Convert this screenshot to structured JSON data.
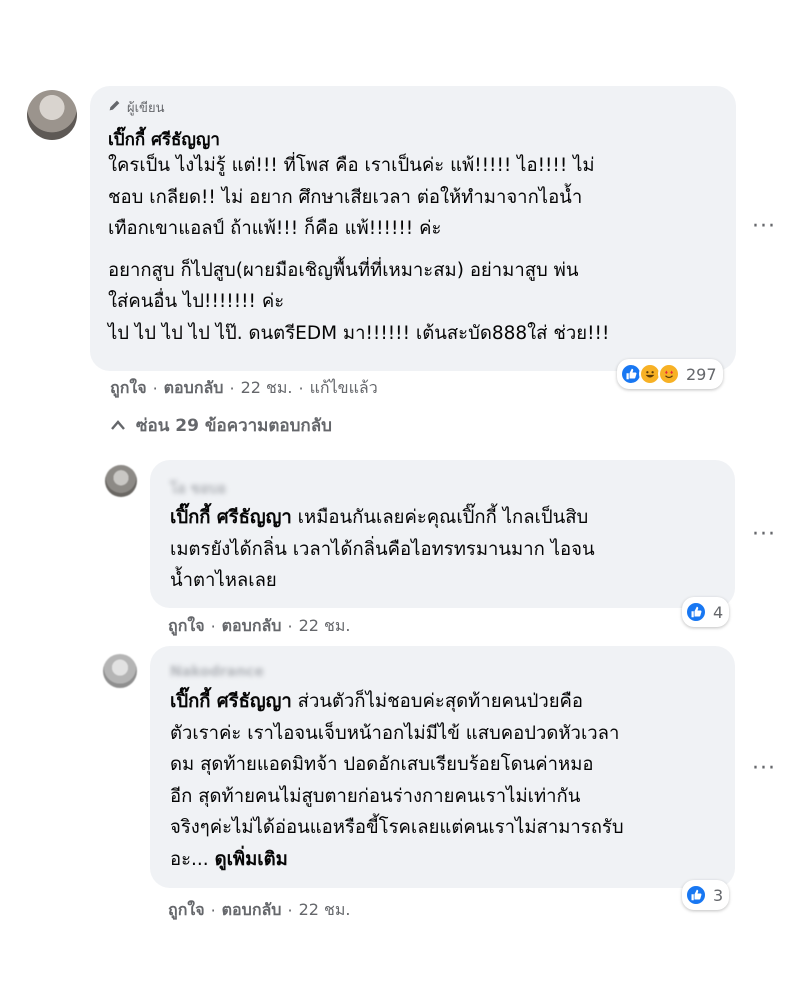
{
  "main_comment": {
    "badge_label": "ผู้เขียน",
    "author": "เปิ๊กกี้ ศรีธัญญา",
    "paragraphs": [
      [
        "ใครเป็น ไงไม่รู้ แต่!!! ที่โพส คือ เราเป็นค่ะ แพ้!!!!! ไอ!!!! ไม่",
        "ชอบ เกลียด!! ไม่ อยาก ศึกษาเสียเวลา ต่อให้ทำมาจากไอน้ำ",
        "เทือกเขาแอลป์ ถ้าแพ้!!! ก็คือ แพ้!!!!!! ค่ะ"
      ],
      [
        "อยากสูบ ก็ไปสูบ(ผายมือเชิญพื้นที่ที่เหมาะสม) อย่ามาสูบ พ่น",
        "ใส่คนอื่น ไป!!!!!!! ค่ะ",
        "ไป ไป ไป ไป ไป๊. ดนตรีEDM มา!!!!!! เต้นสะบัด888ใส่ ช่วย!!!"
      ]
    ],
    "meta": {
      "like": "ถูกใจ",
      "reply": "ตอบกลับ",
      "time": "22 ชม.",
      "edited": "แก้ไขแล้ว"
    },
    "reactions": {
      "icons": [
        "like-icon",
        "haha-icon",
        "love-face-icon"
      ],
      "count": "297"
    }
  },
  "hide_replies": "ซ่อน 29 ข้อความตอบกลับ",
  "replies": [
    {
      "author_blurred": "โอ ขอบอ",
      "mention": "เปิ๊กกี้ ศรีธัญญา",
      "lines": [
        " เหมือนกันเลยค่ะคุณเปิ๊กกี้ ไกลเป็นสิบ",
        "เมตรยังได้กลิ่น เวลาได้กลิ่นคือไอทรทรมานมาก ไอจน",
        "น้ำตาไหลเลย"
      ],
      "meta": {
        "like": "ถูกใจ",
        "reply": "ตอบกลับ",
        "time": "22 ชม."
      },
      "reactions": {
        "icons": [
          "like-icon"
        ],
        "count": "4"
      }
    },
    {
      "author_blurred": "Nakodrance",
      "mention": "เปิ๊กกี้ ศรีธัญญา",
      "lines": [
        " ส่วนตัวก็ไม่ชอบค่ะสุดท้ายคนป่วยคือ",
        "ตัวเราค่ะ เราไอจนเจ็บหน้าอกไม่มีไข้ แสบคอปวดหัวเวลา",
        "ดม สุดท้ายแอดมิทจ้า ปอดอักเสบเรียบร้อยโดนค่าหมอ",
        "อีก สุดท้ายคนไม่สูบตายก่อนร่างกายคนเราไม่เท่ากัน",
        "จริงๆค่ะไม่ได้อ่อนแอหรือขี้โรคเลยแต่คนเราไม่สามารถรับ"
      ],
      "last_prefix": "อะ... ",
      "see_more": "ดูเพิ่มเติม",
      "meta": {
        "like": "ถูกใจ",
        "reply": "ตอบกลับ",
        "time": "22 ชม."
      },
      "reactions": {
        "icons": [
          "like-icon"
        ],
        "count": "3"
      }
    }
  ],
  "more_options_label": "···"
}
